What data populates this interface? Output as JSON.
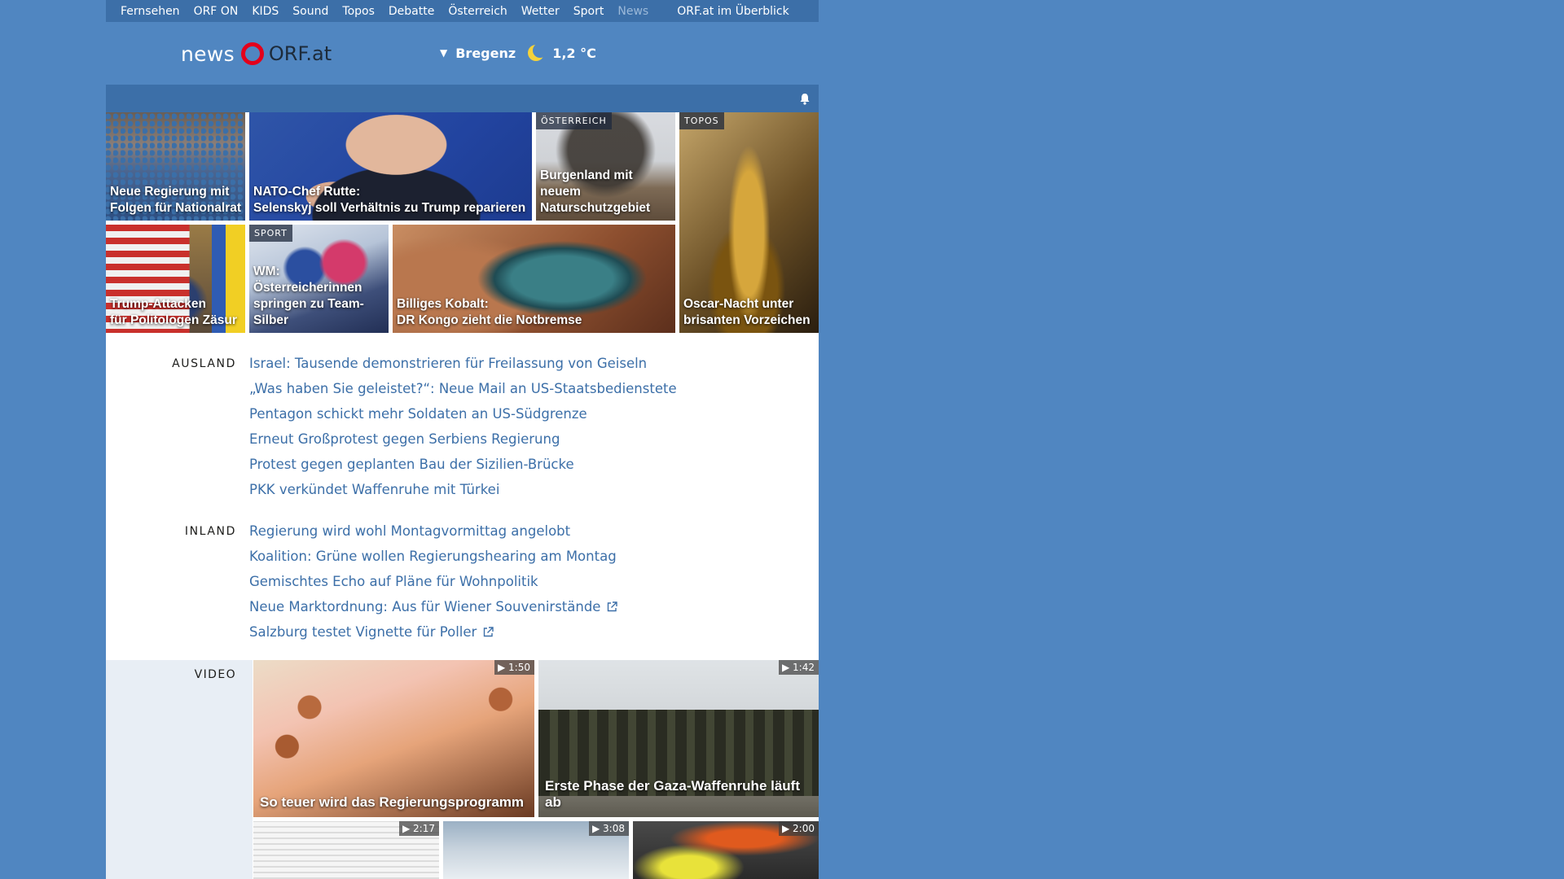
{
  "topnav": {
    "items": [
      "Fernsehen",
      "ORF ON",
      "KIDS",
      "Sound",
      "Topos",
      "Debatte",
      "Österreich",
      "Wetter",
      "Sport",
      "News"
    ],
    "overview": "ORF.at im Überblick"
  },
  "header": {
    "logo_news": "news",
    "logo_orf": "ORF.at",
    "weather_city": "Bregenz",
    "weather_temp": "1,2 °C"
  },
  "tiles": [
    {
      "caption_line1": "Neue Regierung mit",
      "caption_line2": "Folgen für Nationalrat",
      "tag": ""
    },
    {
      "caption_line1": "NATO-Chef Rutte:",
      "caption_line2": "Selenskyj soll Verhältnis zu Trump reparieren",
      "tag": ""
    },
    {
      "caption_line1": "Burgenland mit neuem",
      "caption_line2": "Naturschutzgebiet",
      "tag": "ÖSTERREICH"
    },
    {
      "caption_line1": "Oscar-Nacht unter",
      "caption_line2": "brisanten Vorzeichen",
      "tag": "TOPOS"
    },
    {
      "caption_line1": "Trump-Attacken",
      "caption_line2": "für Politologen Zäsur",
      "tag": ""
    },
    {
      "caption_line1": "WM: Österreicherinnen",
      "caption_line2": "springen zu Team-Silber",
      "tag": "SPORT"
    },
    {
      "caption_line1": "Billiges Kobalt:",
      "caption_line2": "DR Kongo zieht die Notbremse",
      "tag": ""
    }
  ],
  "ausland": {
    "label": "AUSLAND",
    "items": [
      "Israel: Tausende demonstrieren für Freilassung von Geiseln",
      "„Was haben Sie geleistet?“: Neue Mail an US-Staatsbedienstete",
      "Pentagon schickt mehr Soldaten an US-Südgrenze",
      "Erneut Großprotest gegen Serbiens Regierung",
      "Protest gegen geplanten Bau der Sizilien-Brücke",
      "PKK verkündet Waffenruhe mit Türkei"
    ]
  },
  "inland": {
    "label": "INLAND",
    "items": [
      "Regierung wird wohl Montagvormittag angelobt",
      "Koalition: Grüne wollen Regierungshearing am Montag",
      "Gemischtes Echo auf Pläne für Wohnpolitik",
      "Neue Marktordnung: Aus für Wiener Souvenirstände",
      "Salzburg testet Vignette für Poller"
    ]
  },
  "video": {
    "label": "VIDEO",
    "items": [
      {
        "caption": "So teuer wird das Regierungsprogramm",
        "duration": "1:50"
      },
      {
        "caption": "Erste Phase der Gaza-Waffenruhe läuft ab",
        "duration": "1:42"
      },
      {
        "caption": "",
        "duration": "2:17"
      },
      {
        "caption": "",
        "duration": "3:08"
      },
      {
        "caption": "",
        "duration": "2:00"
      }
    ]
  }
}
